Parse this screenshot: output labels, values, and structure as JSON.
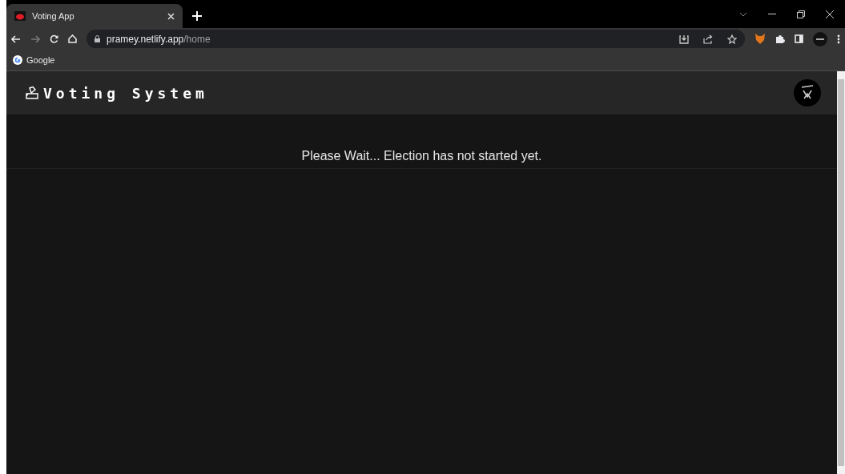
{
  "browser": {
    "tab": {
      "title": "Voting App",
      "selected": true
    },
    "address": {
      "host": "pramey.netlify.app",
      "path": "/home"
    },
    "bookmarks": [
      {
        "label": "Google"
      }
    ]
  },
  "app": {
    "title": "Voting System",
    "message": "Please Wait... Election has not started yet."
  }
}
